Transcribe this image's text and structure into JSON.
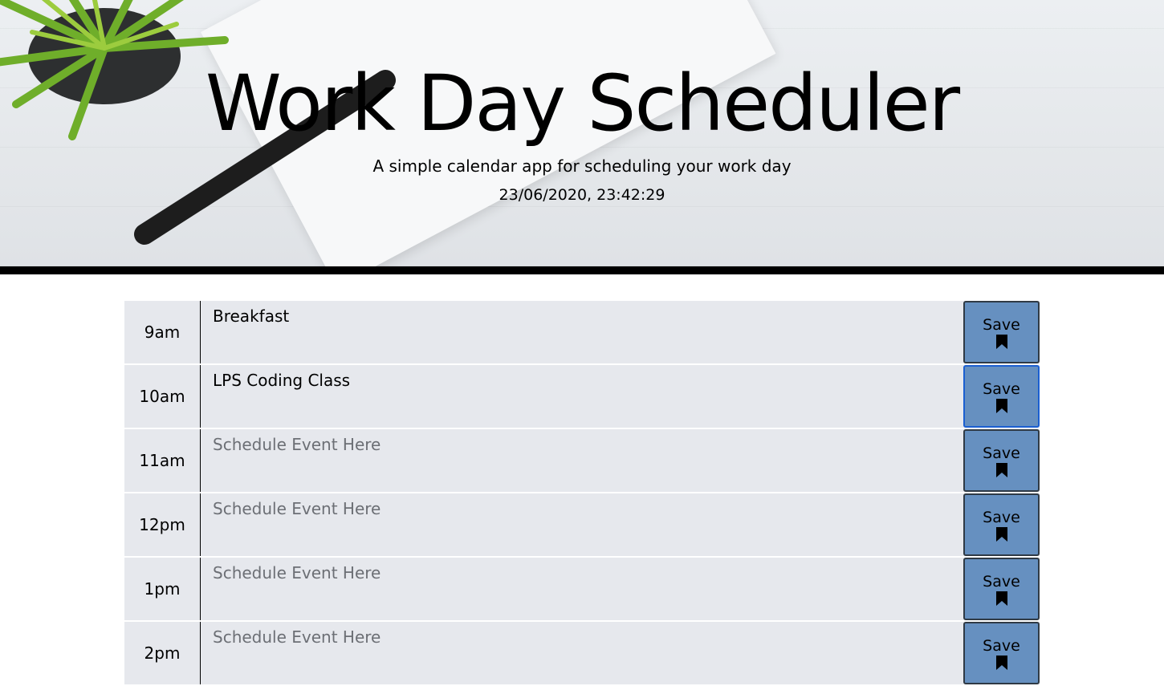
{
  "header": {
    "title": "Work Day Scheduler",
    "subtitle": "A simple calendar app for scheduling your work day",
    "datetime": "23/06/2020, 23:42:29"
  },
  "schedule": {
    "placeholder": "Schedule Event Here",
    "save_label": "Save",
    "rows": [
      {
        "hour": "9am",
        "text": "Breakfast"
      },
      {
        "hour": "10am",
        "text": "LPS Coding Class"
      },
      {
        "hour": "11am",
        "text": ""
      },
      {
        "hour": "12pm",
        "text": ""
      },
      {
        "hour": "1pm",
        "text": ""
      },
      {
        "hour": "2pm",
        "text": ""
      }
    ]
  },
  "colors": {
    "row_background": "#e6e8ed",
    "save_button": "#6690c0",
    "header_border": "#000000"
  },
  "icons": {
    "save": "bookmark-icon"
  }
}
